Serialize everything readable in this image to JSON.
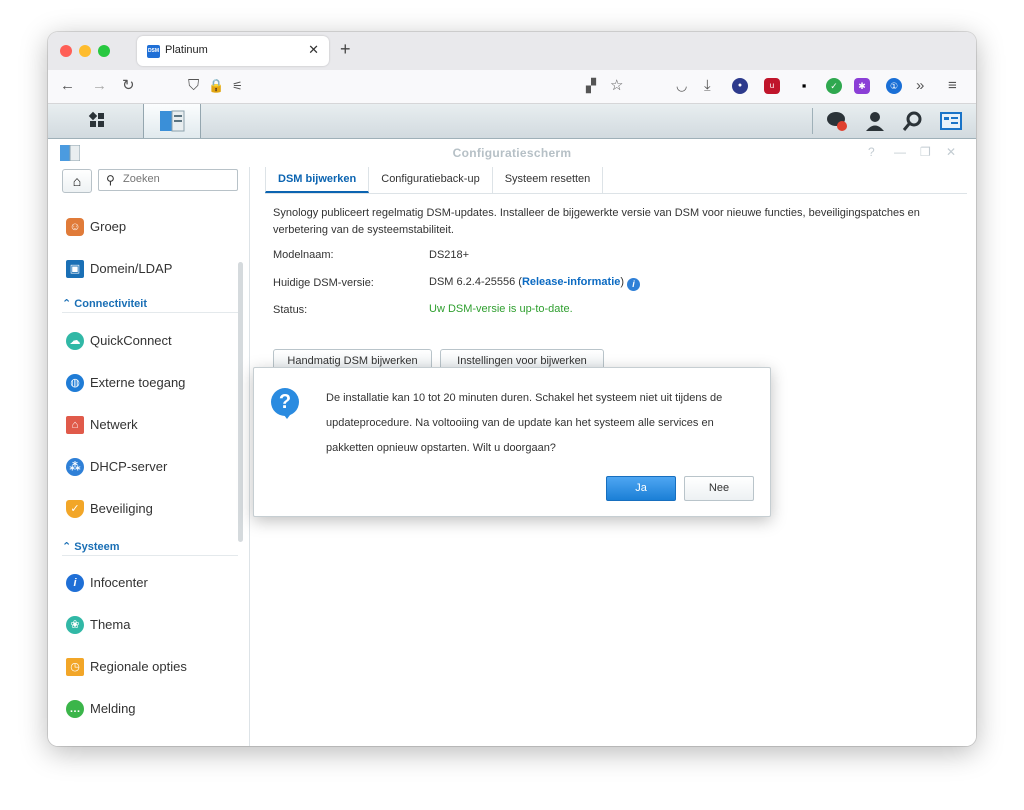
{
  "browser": {
    "tab_title": "Platinum",
    "favicon_text": "DSM",
    "new_tab_symbol": "+"
  },
  "app": {
    "window_title": "Configuratiescherm"
  },
  "sidebar": {
    "search_placeholder": "Zoeken",
    "items_top": [
      {
        "label": "Groep",
        "icon": "group-icon",
        "color": "#e07b39"
      },
      {
        "label": "Domein/LDAP",
        "icon": "domain-icon",
        "color": "#1a6fb5"
      }
    ],
    "section_connectivity": "Connectiviteit",
    "items_connectivity": [
      {
        "label": "QuickConnect",
        "icon": "quickconnect-icon",
        "color": "#31b8a6"
      },
      {
        "label": "Externe toegang",
        "icon": "globe-icon",
        "color": "#1f7cd6"
      },
      {
        "label": "Netwerk",
        "icon": "house-icon",
        "color": "#e05a4a"
      },
      {
        "label": "DHCP-server",
        "icon": "dhcp-icon",
        "color": "#2f80d7"
      },
      {
        "label": "Beveiliging",
        "icon": "shield-icon",
        "color": "#f2a628"
      }
    ],
    "section_system": "Systeem",
    "items_system": [
      {
        "label": "Infocenter",
        "icon": "info-icon",
        "color": "#1f6fd6"
      },
      {
        "label": "Thema",
        "icon": "palette-icon",
        "color": "#31b8a6"
      },
      {
        "label": "Regionale opties",
        "icon": "regional-icon",
        "color": "#f2a628"
      },
      {
        "label": "Melding",
        "icon": "chat-icon",
        "color": "#3bb54a"
      }
    ]
  },
  "main": {
    "tabs": [
      "DSM bijwerken",
      "Configuratieback-up",
      "Systeem resetten"
    ],
    "description": "Synology publiceert regelmatig DSM-updates. Installeer de bijgewerkte versie van DSM voor nieuwe functies, beveiligingspatches en verbetering van de systeemstabiliteit.",
    "model_label": "Modelnaam:",
    "model_value": "DS218+",
    "version_label": "Huidige DSM-versie:",
    "version_value": "DSM 6.2.4-25556 (",
    "release_link": "Release-informatie",
    "version_suffix": ")",
    "status_label": "Status:",
    "status_value": "Uw DSM-versie is up-to-date.",
    "status_color": "#2f9f2f",
    "manual_update_button": "Handmatig DSM bijwerken",
    "update_settings_button": "Instellingen voor bijwerken"
  },
  "dialog": {
    "message": "De installatie kan 10 tot 20 minuten duren. Schakel het systeem niet uit tijdens de updateprocedure. Na voltooiing van de update kan het systeem alle services en pakketten opnieuw opstarten. Wilt u doorgaan?",
    "yes_label": "Ja",
    "no_label": "Nee",
    "accent_color": "#1b7fd6"
  }
}
